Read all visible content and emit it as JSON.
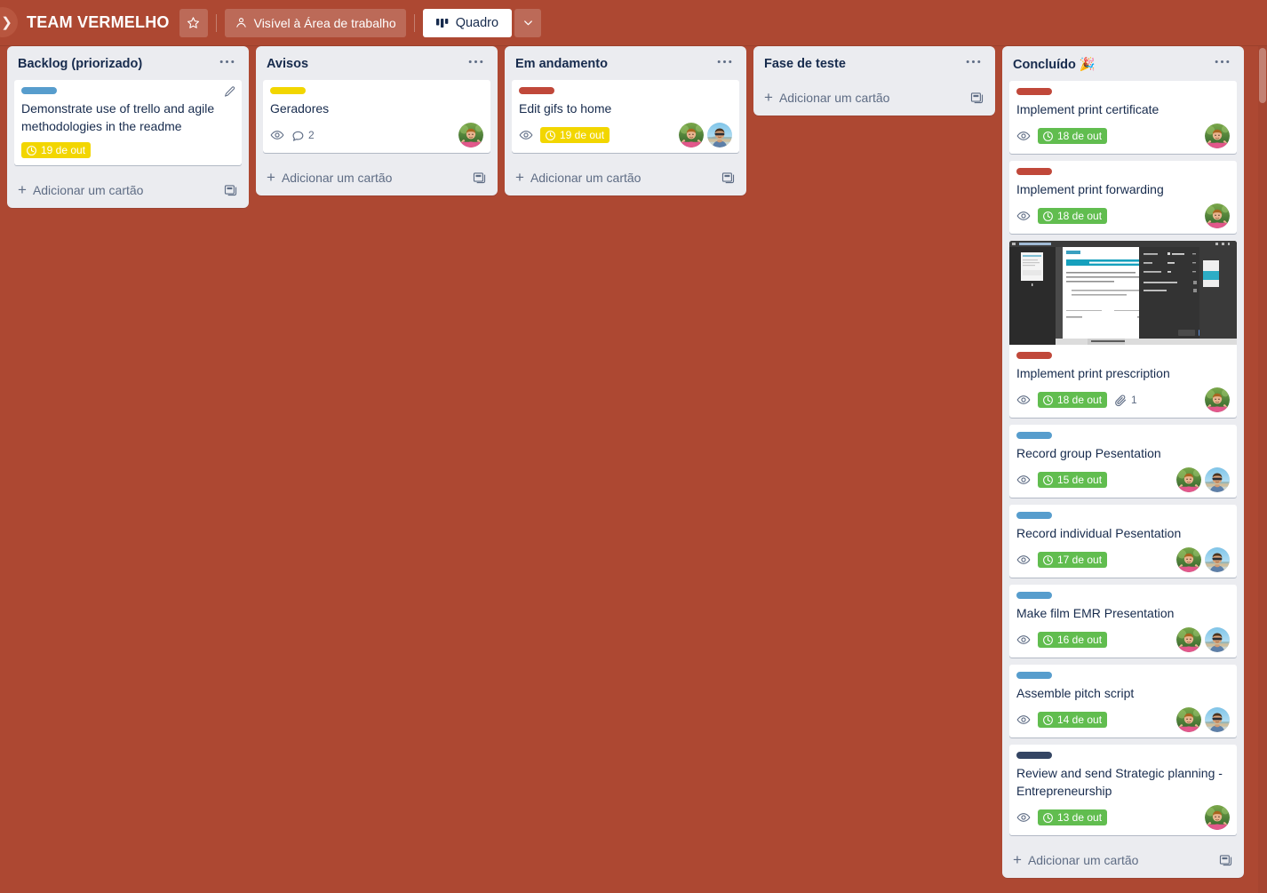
{
  "header": {
    "board_title": "TEAM VERMELHO",
    "star_icon": "star-icon",
    "visibility_label": "Visível à Área de trabalho",
    "visibility_icon": "workspace-people-icon",
    "view_label": "Quadro",
    "view_icon": "board-view-icon",
    "caret_icon": "chevron-down-icon",
    "sidebar_toggle_icon": "chevron-right-icon"
  },
  "colors": {
    "board_background": "#ad4832",
    "list_background": "#ebecf0",
    "card_background": "#ffffff",
    "text_primary": "#172b4d",
    "text_subtle": "#5e6c84",
    "label_blue": "#579dcd",
    "label_yellow": "#f2d600",
    "label_red": "#c0483a",
    "label_navy": "#344563",
    "badge_yellow": "#f2d600",
    "badge_green": "#61bd4f"
  },
  "common": {
    "add_card_label": "Adicionar um cartão",
    "add_card_plus": "+",
    "template_icon": "card-template-icon",
    "list_menu_icon": "list-menu-ellipsis-icon",
    "watch_icon": "eye-watch-icon",
    "comment_icon": "comment-icon",
    "attachment_icon": "attachment-paperclip-icon",
    "due_clock_icon": "clock-icon",
    "edit_icon": "pencil-edit-icon"
  },
  "lists": [
    {
      "title": "Backlog (priorizado)",
      "cards": [
        {
          "title": "Demonstrate use of trello and agile methodologies in the readme",
          "labels": [
            "#579dcd"
          ],
          "due": {
            "text": "19 de out",
            "color": "yellow"
          },
          "watch": false,
          "comments": null,
          "attachments": null,
          "members": [],
          "has_edit_pencil": true,
          "cover": null
        }
      ]
    },
    {
      "title": "Avisos",
      "cards": [
        {
          "title": "Geradores",
          "labels": [
            "#f2d600"
          ],
          "due": null,
          "watch": true,
          "comments": "2",
          "attachments": null,
          "members": [
            "green-pink"
          ],
          "has_edit_pencil": false,
          "cover": null
        }
      ]
    },
    {
      "title": "Em andamento",
      "cards": [
        {
          "title": "Edit gifs to home",
          "labels": [
            "#c0483a"
          ],
          "due": {
            "text": "19 de out",
            "color": "yellow"
          },
          "watch": true,
          "comments": null,
          "attachments": null,
          "members": [
            "green-pink",
            "beach-blue"
          ],
          "has_edit_pencil": false,
          "cover": null
        }
      ]
    },
    {
      "title": "Fase de teste",
      "cards": []
    },
    {
      "title": "Concluído 🎉",
      "cards": [
        {
          "title": "Implement print certificate",
          "labels": [
            "#c0483a"
          ],
          "due": {
            "text": "18 de out",
            "color": "green"
          },
          "watch": true,
          "comments": null,
          "attachments": null,
          "members": [
            "green-pink"
          ],
          "has_edit_pencil": false,
          "cover": null
        },
        {
          "title": "Implement print forwarding",
          "labels": [
            "#c0483a"
          ],
          "due": {
            "text": "18 de out",
            "color": "green"
          },
          "watch": true,
          "comments": null,
          "attachments": null,
          "members": [
            "green-pink"
          ],
          "has_edit_pencil": false,
          "cover": null
        },
        {
          "title": "Implement print prescription",
          "labels": [
            "#c0483a"
          ],
          "due": {
            "text": "18 de out",
            "color": "green"
          },
          "watch": true,
          "comments": null,
          "attachments": "1",
          "members": [
            "green-pink"
          ],
          "has_edit_pencil": false,
          "cover": "print-preview-screenshot"
        },
        {
          "title": "Record group Pesentation",
          "labels": [
            "#579dcd"
          ],
          "due": {
            "text": "15 de out",
            "color": "green"
          },
          "watch": true,
          "comments": null,
          "attachments": null,
          "members": [
            "green-pink",
            "beach-blue"
          ],
          "has_edit_pencil": false,
          "cover": null
        },
        {
          "title": "Record individual Pesentation",
          "labels": [
            "#579dcd"
          ],
          "due": {
            "text": "17 de out",
            "color": "green"
          },
          "watch": true,
          "comments": null,
          "attachments": null,
          "members": [
            "green-pink",
            "beach-blue"
          ],
          "has_edit_pencil": false,
          "cover": null
        },
        {
          "title": "Make film EMR Presentation",
          "labels": [
            "#579dcd"
          ],
          "due": {
            "text": "16 de out",
            "color": "green"
          },
          "watch": true,
          "comments": null,
          "attachments": null,
          "members": [
            "green-pink",
            "beach-blue"
          ],
          "has_edit_pencil": false,
          "cover": null
        },
        {
          "title": "Assemble pitch script",
          "labels": [
            "#579dcd"
          ],
          "due": {
            "text": "14 de out",
            "color": "green"
          },
          "watch": true,
          "comments": null,
          "attachments": null,
          "members": [
            "green-pink",
            "beach-blue"
          ],
          "has_edit_pencil": false,
          "cover": null
        },
        {
          "title": "Review and send Strategic planning - Entrepreneurship",
          "labels": [
            "#344563"
          ],
          "due": {
            "text": "13 de out",
            "color": "green"
          },
          "watch": true,
          "comments": null,
          "attachments": null,
          "members": [
            "green-pink"
          ],
          "has_edit_pencil": false,
          "cover": null
        }
      ]
    }
  ]
}
